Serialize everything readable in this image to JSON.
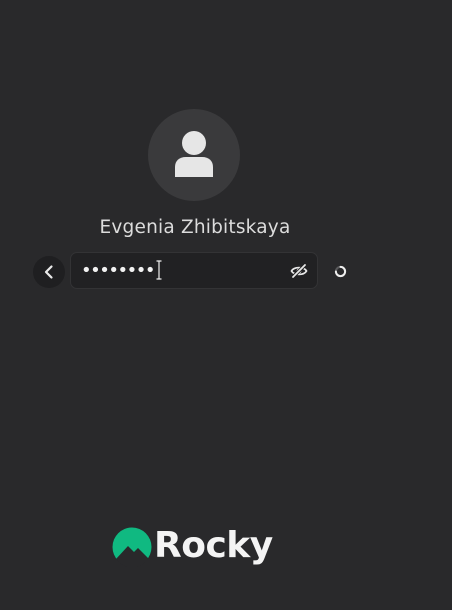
{
  "user": {
    "name": "Evgenia Zhibitskaya"
  },
  "password": {
    "masked_value": "••••••••"
  },
  "icons": {
    "avatar": "user-silhouette-icon",
    "back": "chevron-left-icon",
    "reveal": "eye-slash-icon",
    "spinner": "loading-spinner-icon",
    "cursor": "text-cursor-icon",
    "logo_mark": "rocky-mountain-icon"
  },
  "logo": {
    "text": "Rocky"
  },
  "colors": {
    "background": "#29292b",
    "field_background": "#212123",
    "logo_green": "#10b981",
    "text": "#dcdcdc"
  }
}
